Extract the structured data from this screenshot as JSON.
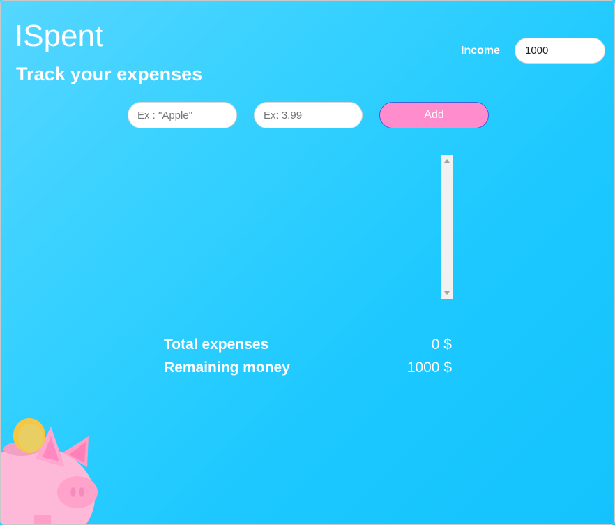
{
  "app": {
    "title": "ISpent",
    "subtitle": "Track your expenses"
  },
  "income": {
    "label": "Income",
    "value": "1000"
  },
  "form": {
    "name_placeholder": "Ex : \"Apple\"",
    "amount_placeholder": "Ex: 3.99",
    "add_label": "Add"
  },
  "expenses": [],
  "summary": {
    "total_label": "Total expenses",
    "total_value": "0 $",
    "remaining_label": "Remaining money",
    "remaining_value": "1000 $"
  },
  "colors": {
    "background_light": "#55d6ff",
    "background_dark": "#14c3fd",
    "add_button": "#ff8ccc",
    "add_button_border": "#4a5cd6",
    "text": "#ffffff"
  },
  "icons": {
    "mascot": "piggy-bank-icon",
    "coin": "coin-icon"
  }
}
